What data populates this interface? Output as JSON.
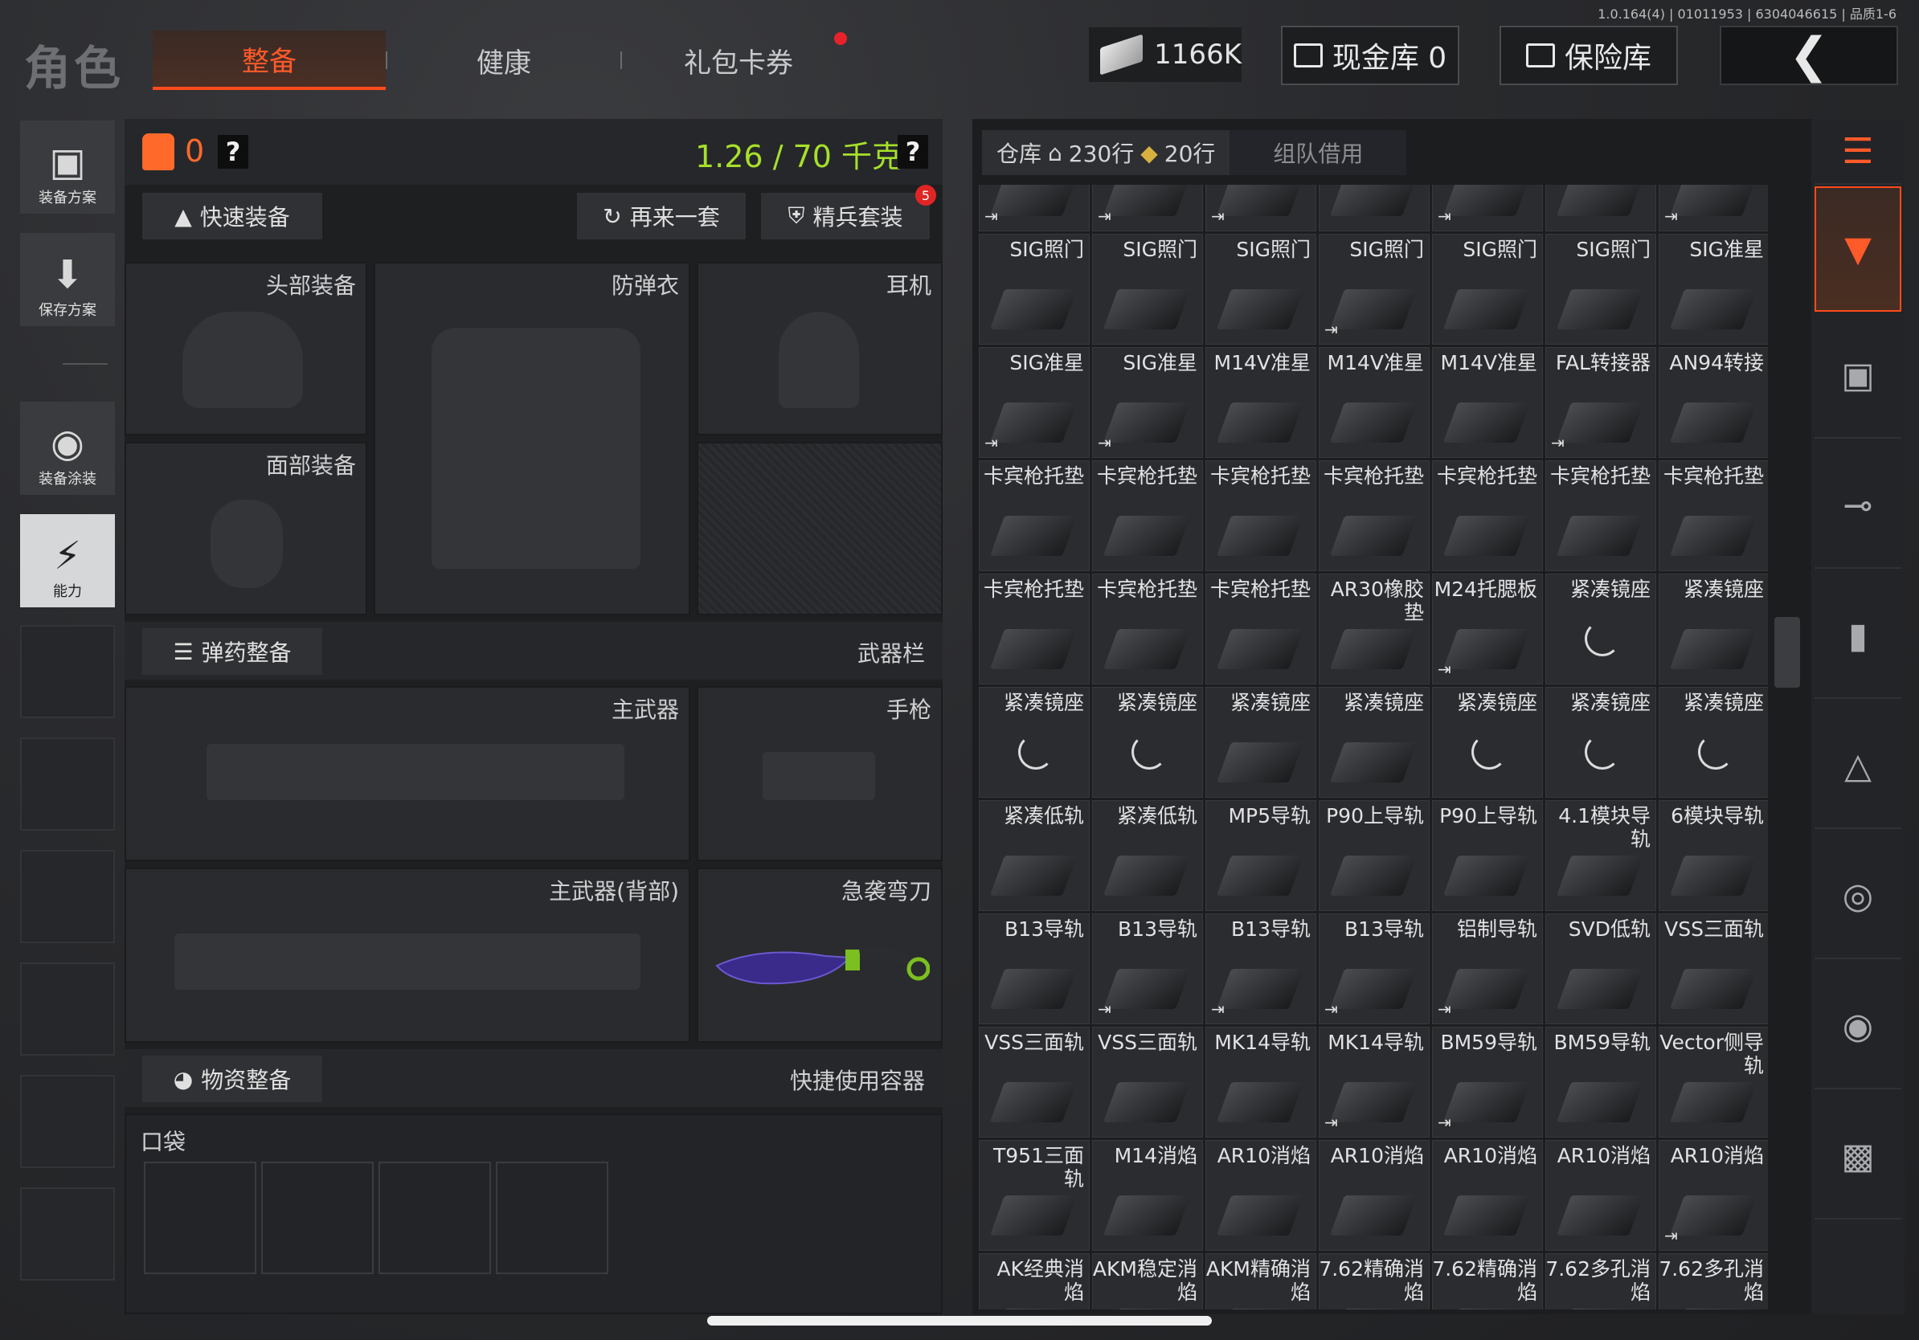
{
  "version": "1.0.164(4) | 01011953 | 6304046615 | 品质1-6",
  "page_title": "角色",
  "tabs": [
    {
      "label": "整备",
      "active": true
    },
    {
      "label": "健康",
      "active": false
    },
    {
      "label": "礼包卡券",
      "active": false
    }
  ],
  "currency": {
    "amount": "1166K"
  },
  "cash_vault": {
    "label": "现金库 0"
  },
  "insurance": {
    "label": "保险库"
  },
  "left_rail": [
    {
      "label": "装备方案",
      "icon": "vest-icon"
    },
    {
      "label": "保存方案",
      "icon": "download-icon"
    },
    {
      "label": "装备涂装",
      "icon": "helmet-icon"
    },
    {
      "label": "能力",
      "icon": "ability-icon",
      "active": true
    }
  ],
  "loadout": {
    "bag_count": "0",
    "weight": "1.26 / 70 千克",
    "quick_equip": "快速装备",
    "again": "再来一套",
    "elite": "精兵套装",
    "elite_badge": "5",
    "slots": {
      "head": "头部装备",
      "armor": "防弹衣",
      "ear": "耳机",
      "face": "面部装备",
      "primary": "主武器",
      "pistol": "手枪",
      "primary_back": "主武器(背部)",
      "melee": "急袭弯刀"
    },
    "ammo_btn": "弹药整备",
    "weapon_bar": "武器栏",
    "supply_btn": "物资整备",
    "quick_container": "快捷使用容器",
    "pocket": "口袋"
  },
  "warehouse": {
    "tab_label": "仓库",
    "rows_home": "230行",
    "rows_ticket": "20行",
    "team_borrow": "组队借用",
    "items": [
      [
        {
          "n": "",
          "s": true
        },
        {
          "n": "",
          "s": true
        },
        {
          "n": "",
          "s": true
        },
        {
          "n": ""
        },
        {
          "n": "",
          "s": true
        },
        {
          "n": ""
        },
        {
          "n": "",
          "s": true
        }
      ],
      [
        {
          "n": "SIG照门"
        },
        {
          "n": "SIG照门"
        },
        {
          "n": "SIG照门"
        },
        {
          "n": "SIG照门",
          "s": true
        },
        {
          "n": "SIG照门"
        },
        {
          "n": "SIG照门"
        },
        {
          "n": "SIG准星"
        }
      ],
      [
        {
          "n": "SIG准星",
          "s": true
        },
        {
          "n": "SIG准星",
          "s": true
        },
        {
          "n": "M14V准星"
        },
        {
          "n": "M14V准星"
        },
        {
          "n": "M14V准星"
        },
        {
          "n": "FAL转接器",
          "s": true
        },
        {
          "n": "AN94转接"
        }
      ],
      [
        {
          "n": "卡宾枪托垫"
        },
        {
          "n": "卡宾枪托垫"
        },
        {
          "n": "卡宾枪托垫"
        },
        {
          "n": "卡宾枪托垫"
        },
        {
          "n": "卡宾枪托垫"
        },
        {
          "n": "卡宾枪托垫"
        },
        {
          "n": "卡宾枪托垫"
        }
      ],
      [
        {
          "n": "卡宾枪托垫"
        },
        {
          "n": "卡宾枪托垫"
        },
        {
          "n": "卡宾枪托垫"
        },
        {
          "n": "AR30橡胶垫"
        },
        {
          "n": "M24托腮板",
          "s": true
        },
        {
          "n": "紧凑镜座",
          "spin": true
        },
        {
          "n": "紧凑镜座"
        }
      ],
      [
        {
          "n": "紧凑镜座",
          "spin": true
        },
        {
          "n": "紧凑镜座",
          "spin": true
        },
        {
          "n": "紧凑镜座"
        },
        {
          "n": "紧凑镜座"
        },
        {
          "n": "紧凑镜座",
          "spin": true
        },
        {
          "n": "紧凑镜座",
          "spin": true
        },
        {
          "n": "紧凑镜座",
          "spin": true
        }
      ],
      [
        {
          "n": "紧凑低轨"
        },
        {
          "n": "紧凑低轨"
        },
        {
          "n": "MP5导轨"
        },
        {
          "n": "P90上导轨"
        },
        {
          "n": "P90上导轨"
        },
        {
          "n": "4.1模块导轨"
        },
        {
          "n": "6模块导轨"
        }
      ],
      [
        {
          "n": "B13导轨"
        },
        {
          "n": "B13导轨",
          "s": true
        },
        {
          "n": "B13导轨",
          "s": true
        },
        {
          "n": "B13导轨",
          "s": true
        },
        {
          "n": "铝制导轨",
          "s": true
        },
        {
          "n": "SVD低轨"
        },
        {
          "n": "VSS三面轨"
        }
      ],
      [
        {
          "n": "VSS三面轨"
        },
        {
          "n": "VSS三面轨"
        },
        {
          "n": "MK14导轨"
        },
        {
          "n": "MK14导轨",
          "s": true
        },
        {
          "n": "BM59导轨",
          "s": true
        },
        {
          "n": "BM59导轨"
        },
        {
          "n": "Vector侧导轨"
        }
      ],
      [
        {
          "n": "T951三面轨"
        },
        {
          "n": "M14消焰"
        },
        {
          "n": "AR10消焰"
        },
        {
          "n": "AR10消焰"
        },
        {
          "n": "AR10消焰"
        },
        {
          "n": "AR10消焰"
        },
        {
          "n": "AR10消焰",
          "s": true
        }
      ],
      [
        {
          "n": "AK经典消焰"
        },
        {
          "n": "AKM稳定消焰"
        },
        {
          "n": "AKM精确消焰"
        },
        {
          "n": "7.62精确消焰"
        },
        {
          "n": "7.62精确消焰"
        },
        {
          "n": "7.62多孔消焰"
        },
        {
          "n": "7.62多孔消焰"
        }
      ]
    ]
  },
  "right_rail": [
    {
      "icon": "stack-icon",
      "active": false
    },
    {
      "icon": "box-download-icon",
      "active": true
    },
    {
      "icon": "armor-icon"
    },
    {
      "icon": "rifle-icon"
    },
    {
      "icon": "magazine-icon"
    },
    {
      "icon": "bullet-icon"
    },
    {
      "icon": "scope-icon"
    },
    {
      "icon": "grenade-icon"
    },
    {
      "icon": "container-icon"
    }
  ]
}
